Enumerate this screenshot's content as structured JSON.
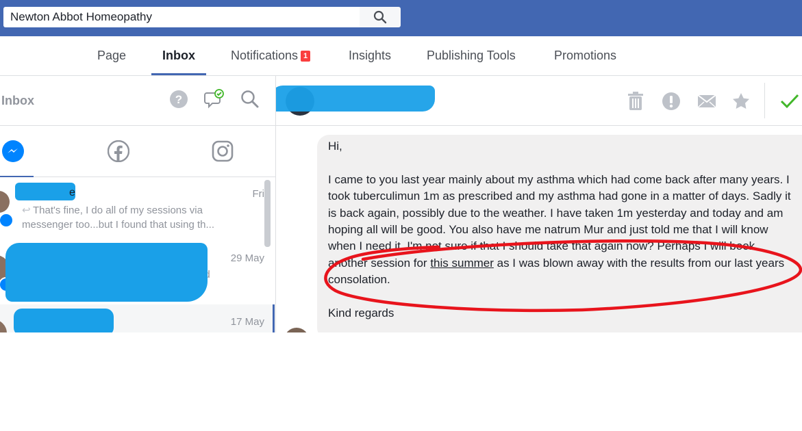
{
  "search": {
    "value": "Newton Abbot Homeopathy"
  },
  "nav": {
    "tabs": [
      {
        "label": "Page"
      },
      {
        "label": "Inbox"
      },
      {
        "label": "Notifications",
        "badge": "1"
      },
      {
        "label": "Insights"
      },
      {
        "label": "Publishing Tools"
      },
      {
        "label": "Promotions"
      }
    ]
  },
  "inbox": {
    "title": "Inbox",
    "threads": [
      {
        "date": "Fri",
        "name_suffix": "e",
        "preview": "That's fine, I do all of my sessions via messenger too...but I found that using th..."
      },
      {
        "date": "29 May",
        "preview_tail": "nd"
      },
      {
        "date": "17 May"
      }
    ]
  },
  "conversation": {
    "greeting": "Hi,",
    "para1_a": "I came to you last year mainly about my asthma which had come back after many years. I took tuberculimun 1m as prescribed and my asthma had gone in a matter of days. Sadly it is back again, possibly due to the weather. I have taken 1m yesterday and today and am hoping all will be good. You also have me natrum Mur and just told me that I will know when I need it. I'm not sure if that I should take that again now? Perhaps I will book another session for ",
    "para1_link": "this summer",
    "para1_b": " as I was blown away with the results from our last years consolation.",
    "signoff": "Kind regards"
  },
  "colors": {
    "brand": "#4267b2",
    "messenger": "#0084ff",
    "badge": "#fa3e3e",
    "annotation": "#e8141c",
    "redaction": "#1aa0e8",
    "done_check": "#42b72a"
  }
}
